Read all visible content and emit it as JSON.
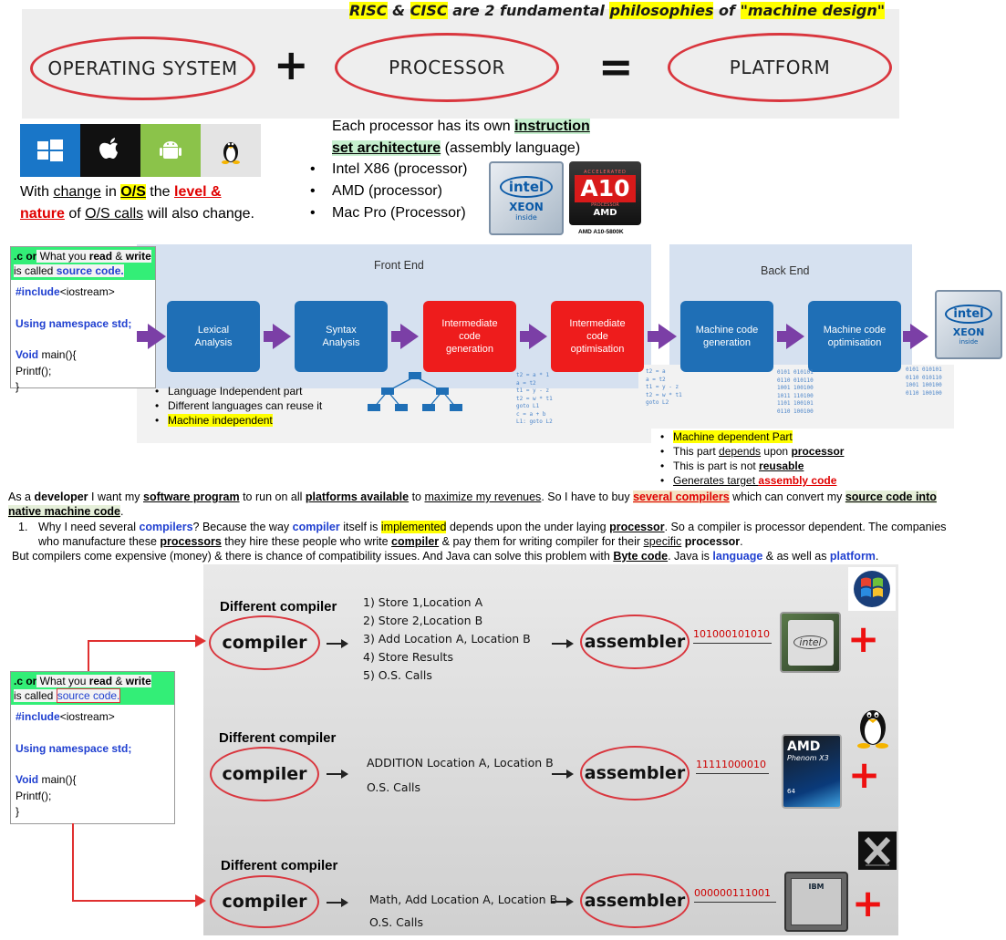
{
  "headline": {
    "p1": "RISC",
    "p2": "&",
    "p3": "CISC",
    "p4": "are 2  fundamental",
    "p5": "philosophies",
    "p6": "of",
    "p7": "\"machine design\""
  },
  "equation": {
    "os": "OPERATING SYSTEM",
    "plus": "+",
    "processor": "PROCESSOR",
    "equals": "=",
    "platform": "PLATFORM"
  },
  "os_icons": [
    "windows-icon",
    "apple-icon",
    "android-icon",
    "linux-icon"
  ],
  "os_note": {
    "t1": "With ",
    "t2": "change",
    "t3": " in ",
    "t4": "O/S",
    "t5": " the ",
    "t6": "level &",
    "t7": "nature",
    "t8": " of ",
    "t9": "O/S calls",
    "t10": " will also change."
  },
  "isa": {
    "t1": "Each processor has its own ",
    "t2": "instruction",
    "t3": "set architecture",
    "t4": " (assembly language)",
    "items": [
      "Intel X86 (processor)",
      "AMD (processor)",
      "Mac Pro (Processor)"
    ]
  },
  "chips": {
    "intel": "intel",
    "xeon": "XEON",
    "inside": "inside",
    "amd_top": "ACCELERATED",
    "a10": "A10",
    "amd_proc": "PROCESSOR",
    "amd": "AMD",
    "amd_caption": "AMD A10-5800K"
  },
  "code": {
    "head1": ".c or",
    "head2": " What you ",
    "head3": "read",
    "head4": " & ",
    "head5": "write",
    "head6": "is called ",
    "head7": "source code.",
    "l1a": "#include",
    "l1b": "<iostream>",
    "l2": "Using namespace std;",
    "l3a": "Void",
    "l3b": " main(){",
    "l4": "Printf();",
    "l5": "}"
  },
  "pipeline": {
    "front_end": "Front End",
    "back_end": "Back End",
    "stages": [
      "Lexical\nAnalysis",
      "Syntax\nAnalysis",
      "Intermediate\ncode\ngeneration",
      "Intermediate\ncode\noptimisation",
      "Machine code\ngeneration",
      "Machine code\noptimisation"
    ]
  },
  "front_bullets": [
    "Language Independent part",
    "Different languages can reuse it",
    "Machine independent"
  ],
  "code_snippets": {
    "ir1": "t2 = a * 1\na = t2\nt1 = y - z\nt2 = w * t1\ngoto L1\nc = a + b\nL1: goto L2",
    "ir2": "t2 = a\na = t2\nt1 = y - z\nt2 = w * t1\ngoto L2",
    "bin1": "0101 010101\n0110 010110\n1001 100100\n1011 110100\n1101 100101\n0110 100100",
    "bin2": "0101 010101\n0110 010110\n1001 100100\n0110 100100"
  },
  "back_bullets": {
    "b1": "Machine dependent Part",
    "b2a": "This part ",
    "b2b": "depends",
    "b2c": " upon ",
    "b2d": "processor",
    "b3a": "This is part is not ",
    "b3b": "reusable",
    "b4a": "Generates target ",
    "b4b": "assembly code"
  },
  "paragraph1": {
    "a": "As a ",
    "b": "developer",
    "c": " I want my ",
    "d": "software program",
    "e": " to run on all ",
    "f": "platforms available",
    "g": " to ",
    "h": "maximize my revenues",
    "i": ". So I have to buy ",
    "j": "several compilers",
    "k": " which can convert my ",
    "l": "source code into",
    "m": "native machine code",
    "n": "."
  },
  "item1": {
    "num": "1.",
    "a": "Why I need several ",
    "b": "compilers",
    "c": "? Because the way ",
    "d": "compiler",
    "e": " itself is ",
    "f": "implemented",
    "g": " depends upon the under laying ",
    "h": "processor",
    "i": ". So a compiler is processor dependent. The companies",
    "j": "who manufacture these ",
    "k": "processors",
    "l": " they hire these people who write ",
    "m": "compiler",
    "n": " & pay them for writing compiler for their ",
    "o": "specific",
    "p": " ",
    "q": "processor",
    "r": "."
  },
  "paragraph2": {
    "a": "But compilers come expensive (money) & there is chance of compatibility issues. And Java can solve this problem with ",
    "b": "Byte code",
    "c": ". Java is ",
    "d": "language",
    "e": " & as well as ",
    "f": "platform",
    "g": "."
  },
  "compilers": [
    {
      "title": "Different compiler",
      "compiler": "compiler",
      "steps": [
        "1) Store 1,Location A",
        "2) Store 2,Location B",
        "3) Add Location A, Location B",
        "4) Store Results",
        "5) O.S. Calls"
      ],
      "assembler": "assembler",
      "binary": "101000101010",
      "plus": "+"
    },
    {
      "title": "Different compiler",
      "compiler": "compiler",
      "steps": [
        "ADDITION Location A, Location B",
        "O.S. Calls"
      ],
      "assembler": "assembler",
      "binary": "11111000010",
      "plus": "+"
    },
    {
      "title": "Different compiler",
      "compiler": "compiler",
      "steps": [
        "Math, Add Location A, Location B",
        "O.S. Calls"
      ],
      "assembler": "assembler",
      "binary": "000000111001",
      "plus": "+"
    }
  ],
  "lower_chips": {
    "intel": "intel",
    "amd": "AMD",
    "phenom": "Phenom X3",
    "num64": "64",
    "ibm": "IBM"
  },
  "colors": {
    "ellipse": "#d9363e",
    "stage_blue": "#1f6fb6",
    "stage_red": "#ee1c1c",
    "arrow_purple": "#7b3fa6",
    "highlight_yellow": "#ffff00",
    "highlight_green": "#33ee77"
  }
}
